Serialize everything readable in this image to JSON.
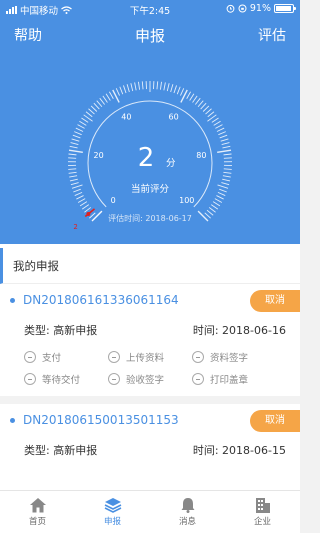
{
  "status_bar": {
    "carrier": "中国移动",
    "time": "下午2:45",
    "battery": "91%",
    "battery_level": 0.91
  },
  "nav": {
    "left": "帮助",
    "title": "申报",
    "right": "评估"
  },
  "gauge": {
    "value": "2",
    "unit": "分",
    "label": "当前评分",
    "date": "评估时间: 2018-06-17",
    "ticks": [
      "0",
      "20",
      "40",
      "60",
      "80",
      "100"
    ],
    "min": 0,
    "max": 100,
    "current": 2,
    "pointer_label": "2"
  },
  "section": {
    "title": "我的申报"
  },
  "orders": [
    {
      "number": "DN201806161336061164",
      "cancel": "取消",
      "type": "类型: 高新申报",
      "time": "时间: 2018-06-16",
      "steps": [
        "支付",
        "上传资料",
        "资料签字",
        "等待交付",
        "验收签字",
        "打印盖章"
      ]
    },
    {
      "number": "DN201806150013501153",
      "cancel": "取消",
      "type": "类型: 高新申报",
      "time": "时间: 2018-06-15"
    }
  ],
  "tabs": [
    {
      "label": "首页",
      "icon": "home-icon"
    },
    {
      "label": "申报",
      "icon": "layers-icon"
    },
    {
      "label": "消息",
      "icon": "bell-icon"
    },
    {
      "label": "企业",
      "icon": "building-icon"
    }
  ],
  "colors": {
    "primary": "#4a90e2",
    "cancel": "#f5a547",
    "pointer": "#e02020"
  }
}
